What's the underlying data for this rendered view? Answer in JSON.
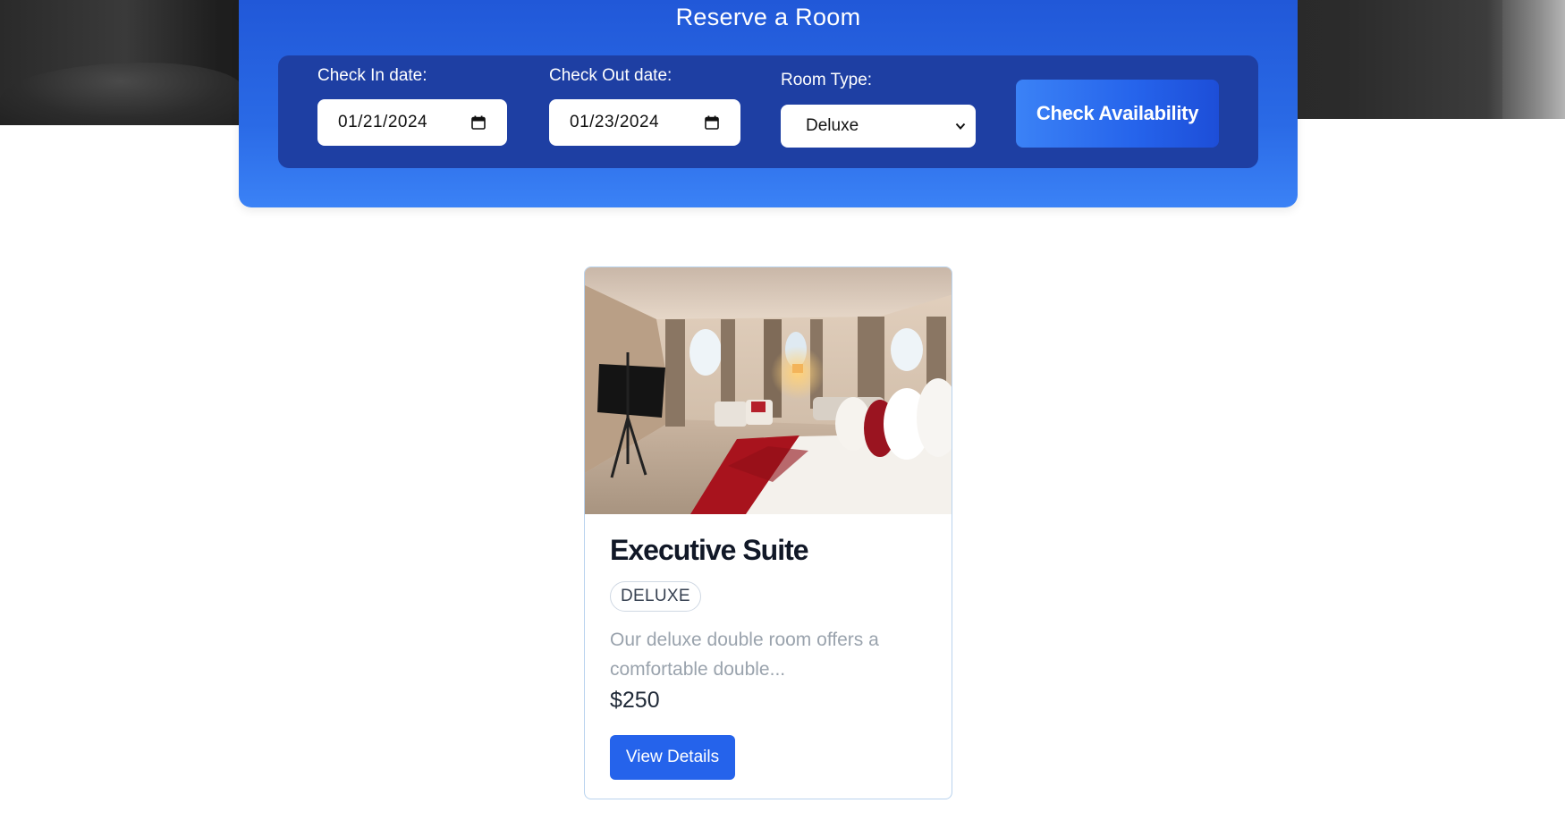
{
  "reservation": {
    "title": "Reserve a Room",
    "check_in_label": "Check In date:",
    "check_in_value": "01/21/2024",
    "check_out_label": "Check Out date:",
    "check_out_value": "01/23/2024",
    "room_type_label": "Room Type:",
    "room_type_value": "Deluxe",
    "check_button": "Check Availability"
  },
  "room_card": {
    "name": "Executive Suite",
    "badge": "DELUXE",
    "description": "Our deluxe double room offers a comfortable double...",
    "price": "$250",
    "details_button": "View Details"
  },
  "colors": {
    "primary": "#2563eb",
    "panel": "#2a6ae6",
    "form": "#1e3fa3"
  },
  "icons": [
    "calendar-icon",
    "chevron-down-icon"
  ]
}
